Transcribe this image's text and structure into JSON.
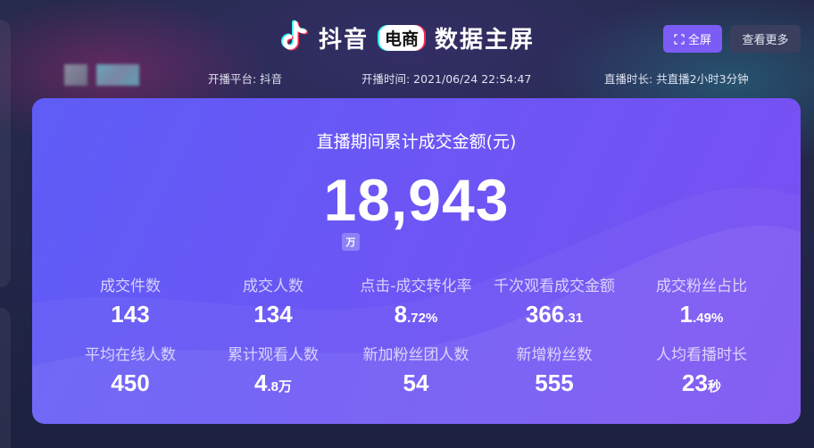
{
  "header": {
    "brand": "抖音",
    "badge": "电商",
    "title": "数据主屏",
    "fullscreen_label": "全屏",
    "more_label": "查看更多"
  },
  "meta": {
    "platform": "开播平台: 抖音",
    "start_time": "开播时间: 2021/06/24 22:54:47",
    "duration": "直播时长: 共直播2小时3分钟"
  },
  "card": {
    "title": "直播期间累计成交金额(元)",
    "total": "18,943",
    "total_unit": "万"
  },
  "metrics": [
    {
      "label": "成交件数",
      "value": "143",
      "suffix": ""
    },
    {
      "label": "成交人数",
      "value": "134",
      "suffix": ""
    },
    {
      "label": "点击-成交转化率",
      "value": "8",
      "suffix": ".72%"
    },
    {
      "label": "千次观看成交金额",
      "value": "366",
      "suffix": ".31"
    },
    {
      "label": "成交粉丝占比",
      "value": "1",
      "suffix": ".49%"
    },
    {
      "label": "平均在线人数",
      "value": "450",
      "suffix": ""
    },
    {
      "label": "累计观看人数",
      "value": "4",
      "suffix": ".8万"
    },
    {
      "label": "新加粉丝团人数",
      "value": "54",
      "suffix": ""
    },
    {
      "label": "新增粉丝数",
      "value": "555",
      "suffix": ""
    },
    {
      "label": "人均看播时长",
      "value": "23",
      "suffix": "秒"
    }
  ],
  "colors": {
    "accent": "#7b5cf5",
    "card_start": "#5f5cf6",
    "card_end": "#7a4ff2",
    "background": "#1f2542"
  },
  "icons": {
    "brand": "tiktok-note-icon",
    "fullscreen": "expand-icon"
  }
}
